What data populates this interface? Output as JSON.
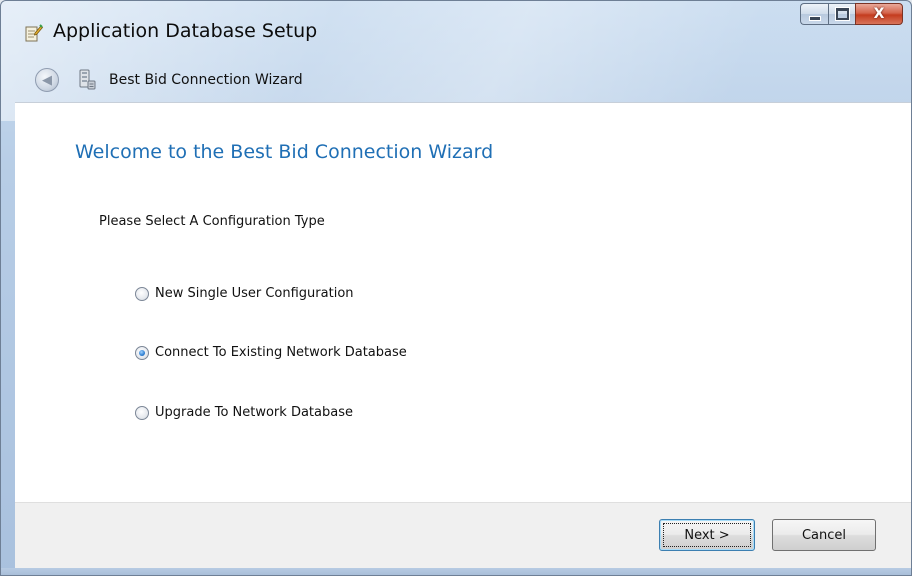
{
  "window": {
    "title": "Application Database Setup",
    "icon": "setup-app-icon",
    "caption_buttons": {
      "minimize_icon": "minimize-icon",
      "maximize_icon": "maximize-icon",
      "close_glyph": "X"
    }
  },
  "nav": {
    "back_icon": "back-arrow-icon",
    "back_glyph": "◀",
    "wizard_icon": "database-wizard-icon",
    "wizard_title": "Best Bid Connection Wizard"
  },
  "main": {
    "heading": "Welcome to the Best Bid Connection Wizard",
    "prompt": "Please Select A Configuration Type",
    "options": [
      {
        "label": "New Single User Configuration",
        "selected": false
      },
      {
        "label": "Connect To Existing Network Database",
        "selected": true
      },
      {
        "label": "Upgrade To Network Database",
        "selected": false
      }
    ]
  },
  "footer": {
    "next_label": "Next >",
    "cancel_label": "Cancel"
  },
  "colors": {
    "heading": "#1f6fb5",
    "close_button": "#c43c1f",
    "selected_radio": "#2f7fd1"
  }
}
